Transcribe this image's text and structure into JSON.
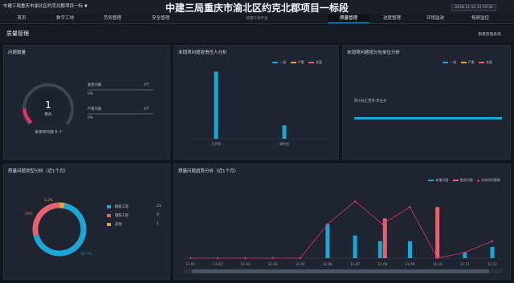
{
  "header": {
    "project_select": "中建三局重庆市渝北区约克北郡项目一标",
    "title": "中建三局重庆市渝北区约克北郡项目一标段",
    "datetime": "2018-11-12 15:19:41"
  },
  "nav": {
    "left": [
      "首页",
      "数字工地",
      "劳务管理",
      "安全管理"
    ],
    "center": "智慧工地平台",
    "right": [
      "质量管理",
      "进度管理",
      "环境监测",
      "视频监控"
    ],
    "active": "质量管理"
  },
  "page": {
    "title": "质量管理",
    "subtitle": "质量管理系统"
  },
  "issue_count": {
    "title": "问题数量",
    "gauge_value": "1",
    "gauge_label": "整改",
    "unresolved": "未销项问题 6 个",
    "rows": [
      {
        "label": "复查问题",
        "count": "0个",
        "pct": "0%"
      },
      {
        "label": "严重问题",
        "count": "0个",
        "pct": "0%"
      }
    ],
    "gauge_fraction": 0.14
  },
  "person_chart": {
    "title": "未销项问题按责任人分析",
    "legend": [
      "一般",
      "严重",
      "紧要"
    ],
    "colors": [
      "#1aa7d6",
      "#e3a43b",
      "#e8616f"
    ],
    "chart_data": {
      "type": "bar",
      "categories": [
        "王开荣",
        "谭伟良"
      ],
      "series": [
        {
          "name": "一般",
          "values": [
            5,
            1
          ]
        }
      ],
      "ylim": [
        0,
        5.5
      ]
    }
  },
  "unit_chart": {
    "title": "未销项问题按分包单位分析",
    "legend": [
      "一般",
      "严重",
      "紧要"
    ],
    "unit_label": "四川长汇劳务-李玉文",
    "unit_fraction": 1.0
  },
  "type_chart": {
    "title": "质量问题类型分析（近1个月）",
    "chart_data": {
      "type": "pie",
      "labels": [
        "模板工程",
        "钢筋工程",
        "其他"
      ],
      "values": [
        21,
        9,
        1
      ],
      "percent_labels": [
        "67.7%",
        "29%",
        "3.2%"
      ]
    },
    "colors": [
      "#1aa7d6",
      "#e8616f",
      "#e3a43b"
    ],
    "legend_values": [
      "21",
      "9",
      "1"
    ]
  },
  "trend_chart": {
    "title": "质量问题趋势分析（近1个月）",
    "legend": [
      "新增问题",
      "整改问题",
      "未销项问题数"
    ],
    "colors": [
      "#1aa7d6",
      "#e8616f",
      "#e0306e"
    ],
    "chart_data": {
      "type": "bar",
      "categories": [
        "11-01",
        "11-02",
        "11-03",
        "11-04",
        "11-05",
        "11-06",
        "11-07",
        "11-08",
        "11-09",
        "11-10",
        "11-11",
        "11-12"
      ],
      "series": [
        {
          "name": "新增问题",
          "values": [
            0,
            0,
            0,
            0,
            0,
            6,
            4,
            3,
            3,
            0,
            1,
            2
          ]
        },
        {
          "name": "整改问题",
          "values": [
            0,
            0,
            0,
            0,
            0,
            0,
            0,
            7,
            0,
            9,
            0,
            0
          ]
        },
        {
          "name": "未销项问题数",
          "values": [
            0,
            0,
            0,
            0,
            0,
            6,
            10,
            6,
            9,
            0,
            1,
            3
          ]
        }
      ],
      "ylim": [
        0,
        12
      ]
    }
  }
}
